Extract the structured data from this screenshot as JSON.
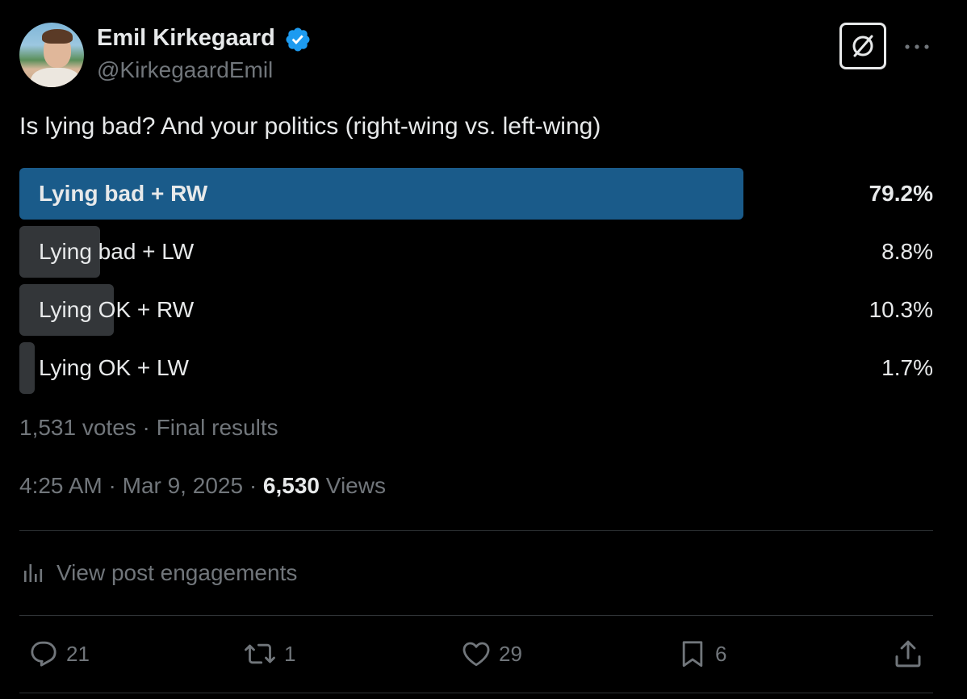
{
  "author": {
    "display_name": "Emil Kirkegaard",
    "handle": "@KirkegaardEmil",
    "verified": true
  },
  "header_icons": {
    "grok": "grok-slash-circle-icon",
    "more": "more-horizontal-icon"
  },
  "post": {
    "text": "Is lying bad? And your politics (right-wing vs. left-wing)"
  },
  "poll": {
    "options": [
      {
        "label": "Lying bad + RW",
        "percent": "79.2%",
        "share": 79.2,
        "winner": true
      },
      {
        "label": "Lying bad + LW",
        "percent": "8.8%",
        "share": 8.8,
        "winner": false
      },
      {
        "label": "Lying OK + RW",
        "percent": "10.3%",
        "share": 10.3,
        "winner": false
      },
      {
        "label": "Lying OK + LW",
        "percent": "1.7%",
        "share": 1.7,
        "winner": false
      }
    ],
    "meta": "1,531 votes · Final results"
  },
  "timestamp": {
    "time_date": "4:25 AM · Mar 9, 2025 · ",
    "views_count": "6,530",
    "views_label": " Views"
  },
  "engagements": {
    "label": "View post engagements"
  },
  "actions": {
    "replies": "21",
    "reposts": "1",
    "likes": "29",
    "bookmarks": "6"
  },
  "colors": {
    "background": "#000000",
    "text_primary": "#e7e9ea",
    "text_secondary": "#71767b",
    "poll_winner": "#1a5b8a",
    "poll_bar": "#333639",
    "divider": "#2f3336",
    "verified_badge": "#1d9bf0"
  }
}
